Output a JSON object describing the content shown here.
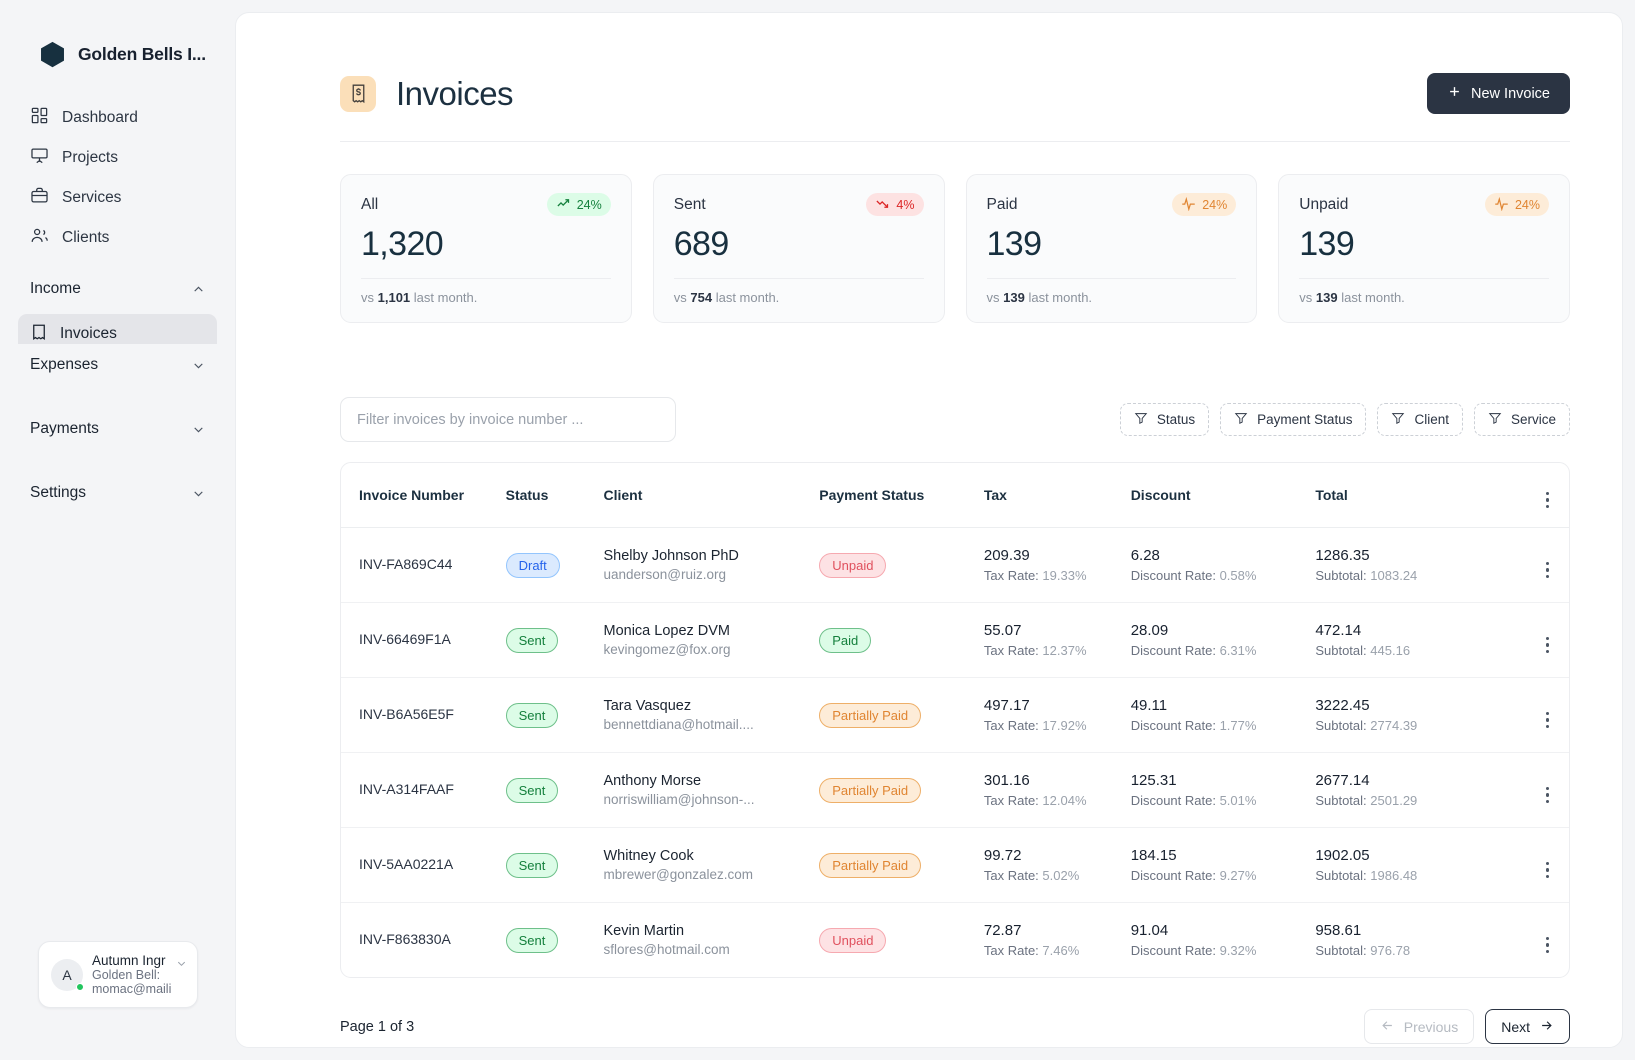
{
  "sidebar": {
    "brand": {
      "name": "Golden Bells I...",
      "logo_icon": "hexagon-logo"
    },
    "nav": [
      {
        "label": "Dashboard",
        "icon": "dashboard-icon"
      },
      {
        "label": "Projects",
        "icon": "projects-icon"
      },
      {
        "label": "Services",
        "icon": "services-icon"
      },
      {
        "label": "Clients",
        "icon": "clients-icon"
      }
    ],
    "groups": [
      {
        "label": "Income",
        "expanded": true,
        "icon": "chevron-up-icon"
      },
      {
        "label": "Expenses",
        "expanded": false,
        "icon": "chevron-down-icon"
      },
      {
        "label": "Payments",
        "expanded": false,
        "icon": "chevron-down-icon"
      },
      {
        "label": "Settings",
        "expanded": false,
        "icon": "chevron-down-icon"
      }
    ],
    "income_selected_item": {
      "label": "Invoices",
      "icon": "invoice-icon"
    },
    "user": {
      "initial": "A",
      "name": "Autumn Ingr",
      "org": "Golden Bell:",
      "email": "momac@maili",
      "status": "online"
    }
  },
  "header": {
    "title": "Invoices",
    "title_icon": "receipt-dollar-icon",
    "new_invoice_label": "New Invoice",
    "new_invoice_icon": "plus-icon",
    "accent_color": "#2b3443"
  },
  "stats": [
    {
      "label": "All",
      "value": "1,320",
      "delta": "24%",
      "trend": "up",
      "trend_icon": "trend-up-icon",
      "footer_prefix": "vs",
      "footer_value": "1,101",
      "footer_suffix": "last month."
    },
    {
      "label": "Sent",
      "value": "689",
      "delta": "4%",
      "trend": "down",
      "trend_icon": "trend-down-icon",
      "footer_prefix": "vs",
      "footer_value": "754",
      "footer_suffix": "last month."
    },
    {
      "label": "Paid",
      "value": "139",
      "delta": "24%",
      "trend": "flat",
      "trend_icon": "activity-icon",
      "footer_prefix": "vs",
      "footer_value": "139",
      "footer_suffix": "last month."
    },
    {
      "label": "Unpaid",
      "value": "139",
      "delta": "24%",
      "trend": "flat",
      "trend_icon": "activity-icon",
      "footer_prefix": "vs",
      "footer_value": "139",
      "footer_suffix": "last month."
    }
  ],
  "filters": {
    "search_placeholder": "Filter invoices by invoice number ...",
    "search_value": "",
    "chips": [
      {
        "label": "Status",
        "icon": "filter-icon"
      },
      {
        "label": "Payment Status",
        "icon": "filter-icon"
      },
      {
        "label": "Client",
        "icon": "filter-icon"
      },
      {
        "label": "Service",
        "icon": "filter-icon"
      }
    ]
  },
  "table": {
    "columns": [
      "Invoice Number",
      "Status",
      "Client",
      "Payment Status",
      "Tax",
      "Discount",
      "Total"
    ],
    "menu_icon": "more-vertical-icon",
    "tax_rate_label": "Tax Rate:",
    "discount_rate_label": "Discount Rate:",
    "subtotal_label": "Subtotal:",
    "rows": [
      {
        "invoice": "INV-FA869C44",
        "status": "Draft",
        "status_type": "draft",
        "client": "Shelby Johnson PhD",
        "email": "uanderson@ruiz.org",
        "payment": "Unpaid",
        "payment_type": "unpaid",
        "tax": "209.39",
        "tax_rate": "19.33%",
        "discount": "6.28",
        "discount_rate": "0.58%",
        "total": "1286.35",
        "subtotal": "1083.24"
      },
      {
        "invoice": "INV-66469F1A",
        "status": "Sent",
        "status_type": "sent",
        "client": "Monica Lopez DVM",
        "email": "kevingomez@fox.org",
        "payment": "Paid",
        "payment_type": "paid",
        "tax": "55.07",
        "tax_rate": "12.37%",
        "discount": "28.09",
        "discount_rate": "6.31%",
        "total": "472.14",
        "subtotal": "445.16"
      },
      {
        "invoice": "INV-B6A56E5F",
        "status": "Sent",
        "status_type": "sent",
        "client": "Tara Vasquez",
        "email": "bennettdiana@hotmail....",
        "payment": "Partially Paid",
        "payment_type": "partial",
        "tax": "497.17",
        "tax_rate": "17.92%",
        "discount": "49.11",
        "discount_rate": "1.77%",
        "total": "3222.45",
        "subtotal": "2774.39"
      },
      {
        "invoice": "INV-A314FAAF",
        "status": "Sent",
        "status_type": "sent",
        "client": "Anthony Morse",
        "email": "norriswilliam@johnson-...",
        "payment": "Partially Paid",
        "payment_type": "partial",
        "tax": "301.16",
        "tax_rate": "12.04%",
        "discount": "125.31",
        "discount_rate": "5.01%",
        "total": "2677.14",
        "subtotal": "2501.29"
      },
      {
        "invoice": "INV-5AA0221A",
        "status": "Sent",
        "status_type": "sent",
        "client": "Whitney Cook",
        "email": "mbrewer@gonzalez.com",
        "payment": "Partially Paid",
        "payment_type": "partial",
        "tax": "99.72",
        "tax_rate": "5.02%",
        "discount": "184.15",
        "discount_rate": "9.27%",
        "total": "1902.05",
        "subtotal": "1986.48"
      },
      {
        "invoice": "INV-F863830A",
        "status": "Sent",
        "status_type": "sent",
        "client": "Kevin Martin",
        "email": "sflores@hotmail.com",
        "payment": "Unpaid",
        "payment_type": "unpaid",
        "tax": "72.87",
        "tax_rate": "7.46%",
        "discount": "91.04",
        "discount_rate": "9.32%",
        "total": "958.61",
        "subtotal": "976.78"
      }
    ]
  },
  "pagination": {
    "info": "Page 1 of 3",
    "previous_label": "Previous",
    "previous_icon": "arrow-left-icon",
    "previous_disabled": true,
    "next_label": "Next",
    "next_icon": "arrow-right-icon"
  }
}
